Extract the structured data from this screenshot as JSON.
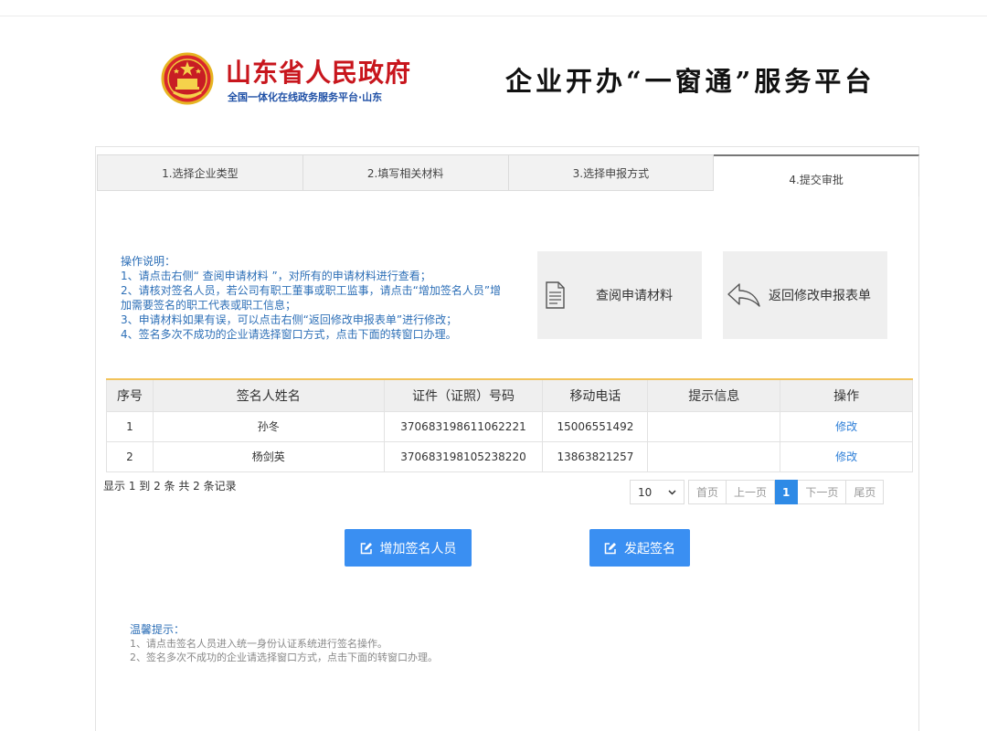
{
  "header": {
    "gov_name": "山东省人民政府",
    "gov_sub": "全国一体化在线政务服务平台·山东",
    "platform_title": "企业开办“一窗通”服务平台"
  },
  "steps": [
    {
      "label": "1.选择企业类型"
    },
    {
      "label": "2.填写相关材料"
    },
    {
      "label": "3.选择申报方式"
    },
    {
      "label": "4.提交审批"
    }
  ],
  "instructions": {
    "title": "操作说明：",
    "lines": [
      "1、请点击右侧“ 查阅申请材料 ”，对所有的申请材料进行查看；",
      "2、请核对签名人员，若公司有职工董事或职工监事，请点击“增加签名人员”增",
      "加需要签名的职工代表或职工信息；",
      "3、申请材料如果有误，可以点击右侧“返回修改申报表单”进行修改；",
      "4、签名多次不成功的企业请选择窗口方式，点击下面的转窗口办理。"
    ]
  },
  "actions": {
    "view_label": "查阅申请材料",
    "return_label": "返回修改申报表单"
  },
  "table": {
    "headers": [
      "序号",
      "签名人姓名",
      "证件（证照）号码",
      "移动电话",
      "提示信息",
      "操作"
    ],
    "rows": [
      {
        "no": "1",
        "name": "孙冬",
        "id": "370683198611062221",
        "phone": "15006551492",
        "tip": "",
        "op": "修改"
      },
      {
        "no": "2",
        "name": "杨剑英",
        "id": "370683198105238220",
        "phone": "13863821257",
        "tip": "",
        "op": "修改"
      }
    ]
  },
  "records_text": "显示 1 到 2 条 共 2 条记录",
  "pager": {
    "page_size": "10",
    "first": "首页",
    "prev": "上一页",
    "current": "1",
    "next": "下一页",
    "last": "尾页"
  },
  "buttons": {
    "add_signer": "增加签名人员",
    "start_sign": "发起签名"
  },
  "tips": {
    "title": "温馨提示：",
    "lines": [
      "1、请点击签名人员进入统一身份认证系统进行签名操作。",
      "2、签名多次不成功的企业请选择窗口方式，点击下面的转窗口办理。"
    ]
  },
  "colors": {
    "gov_red": "#c8161d",
    "link_blue": "#2d6fb7",
    "button_blue": "#3a8ff2",
    "table_accent": "#f2c35b"
  }
}
